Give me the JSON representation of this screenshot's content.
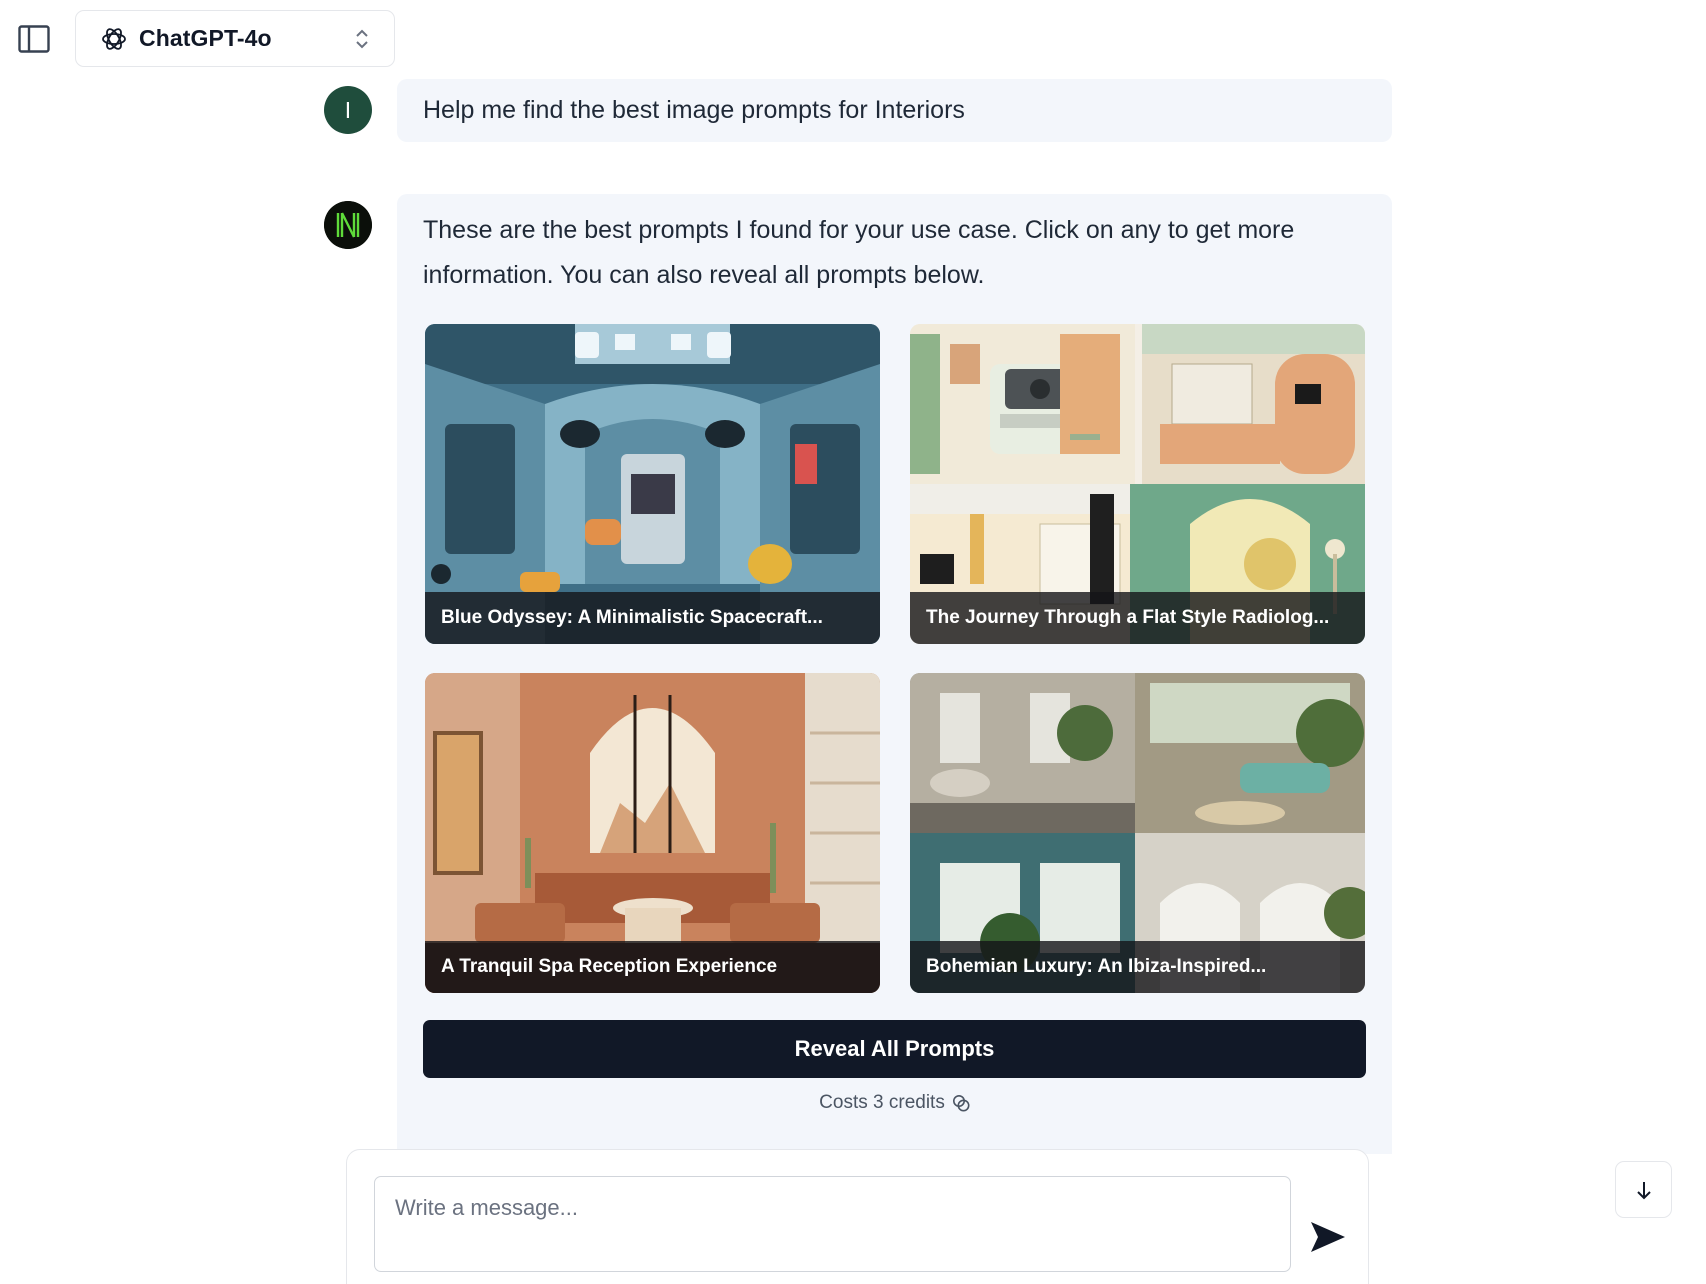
{
  "header": {
    "sidebar_toggle_icon": "sidebar-panel-icon",
    "model": {
      "icon": "openai-logo-icon",
      "label": "ChatGPT-4o",
      "chevron_icon": "chevron-up-down-icon"
    }
  },
  "conversation": {
    "user_message": {
      "avatar_initial": "I",
      "avatar_color": "#1f4d3c",
      "text": "Help me find the best image prompts for Interiors"
    },
    "assistant_message": {
      "avatar_icon": "n-logo-icon",
      "text": "These are the best prompts I found for your use case. Click on any to get more information. You can also reveal all prompts below.",
      "cards": [
        {
          "title": "Blue Odyssey: A Minimalistic Spacecraft...",
          "image": "spacecraft-interior-illustration"
        },
        {
          "title": "The Journey Through a Flat Style Radiolog...",
          "image": "flat-style-radiology-rooms-illustration"
        },
        {
          "title": "A Tranquil Spa Reception Experience",
          "image": "desert-spa-reception-photo"
        },
        {
          "title": "Bohemian Luxury: An Ibiza-Inspired...",
          "image": "bohemian-ibiza-interiors-collage"
        }
      ],
      "reveal_button_label": "Reveal All Prompts",
      "credits_text": "Costs 3 credits",
      "credits_icon": "coins-icon"
    }
  },
  "composer": {
    "placeholder": "Write a message...",
    "value": "",
    "send_icon": "send-arrow-icon"
  },
  "scroll_down_icon": "arrow-down-icon",
  "colors": {
    "accent_dark": "#111827",
    "bubble_bg": "#f3f6fb",
    "user_avatar": "#1f4d3c"
  }
}
